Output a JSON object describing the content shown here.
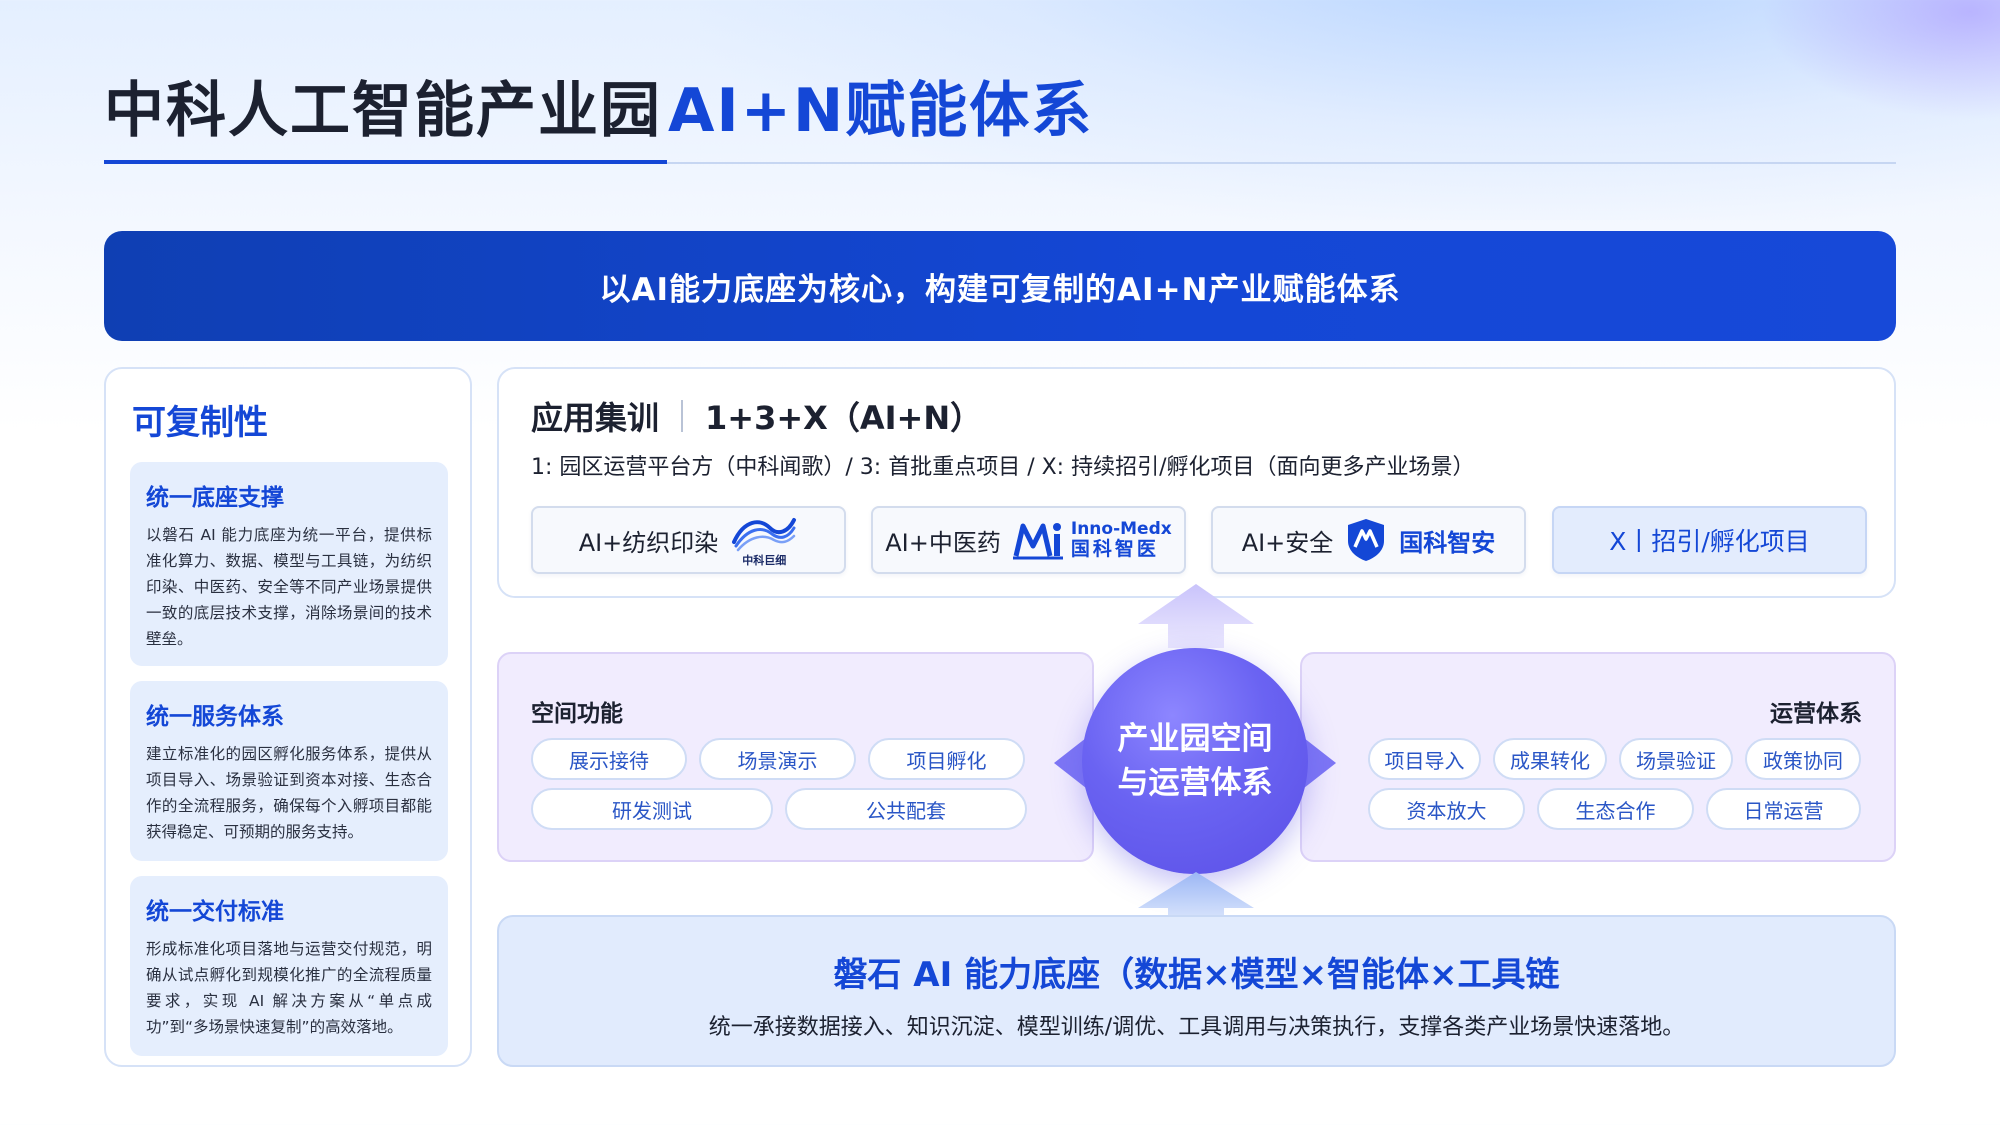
{
  "title": {
    "main": "中科人工智能产业园",
    "accent": "AI+N赋能体系"
  },
  "banner": "以AI能力底座为核心，构建可复制的AI+N产业赋能体系",
  "left_panel": {
    "title": "可复制性",
    "cards": [
      {
        "title": "统一底座支撑",
        "body": "以磐石 AI 能力底座为统一平台，提供标准化算力、数据、模型与工具链，为纺织印染、中医药、安全等不同产业场景提供一致的底层技术支撑，消除场景间的技术壁垒。"
      },
      {
        "title": "统一服务体系",
        "body": "建立标准化的园区孵化服务体系，提供从项目导入、场景验证到资本对接、生态合作的全流程服务，确保每个入孵项目都能获得稳定、可预期的服务支持。"
      },
      {
        "title": "统一交付标准",
        "body": "形成标准化项目落地与运营交付规范，明确从试点孵化到规模化推广的全流程质量要求，实现 AI 解决方案从“单点成功”到“多场景快速复制”的高效落地。"
      }
    ]
  },
  "app_panel": {
    "heading": "应用集训",
    "formula": "1+3+X（AI+N）",
    "subtitle": "1:  园区运营平台方（中科闻歌）/ 3:  首批重点项目  /   X:  持续招引/孵化项目（面向更多产业场景）",
    "boxes": [
      {
        "label": "AI+纺织印染",
        "logo_text": "中科巨细",
        "icon": "wave-logo-icon"
      },
      {
        "label": "AI+中医药",
        "logo_text_en": "Inno-Medx",
        "logo_text_cn": "国科智医",
        "icon": "mxi-logo-icon"
      },
      {
        "label": "AI+安全",
        "logo_text": "国科智安",
        "icon": "shield-logo-icon"
      },
      {
        "label": "X丨招引/孵化项目"
      }
    ]
  },
  "space_panel": {
    "title": "空间功能",
    "pills": [
      "展示接待",
      "场景演示",
      "项目孵化",
      "研发测试",
      "公共配套"
    ]
  },
  "center": {
    "line1": "产业园空间",
    "line2": "与运营体系"
  },
  "ops_panel": {
    "title": "运营体系",
    "pills": [
      "项目导入",
      "成果转化",
      "场景验证",
      "政策协同",
      "资本放大",
      "生态合作",
      "日常运营"
    ]
  },
  "bottom": {
    "title": "磐石 AI 能力底座（数据×模型×智能体×工具链",
    "desc": "统一承接数据接入、知识沉淀、模型训练/调优、工具调用与决策执行，支撑各类产业场景快速落地。"
  },
  "colors": {
    "primary": "#1447d6",
    "purple": "#6a63f2",
    "lavender": "#f1ecfe",
    "light_blue": "#e1ebfd"
  }
}
